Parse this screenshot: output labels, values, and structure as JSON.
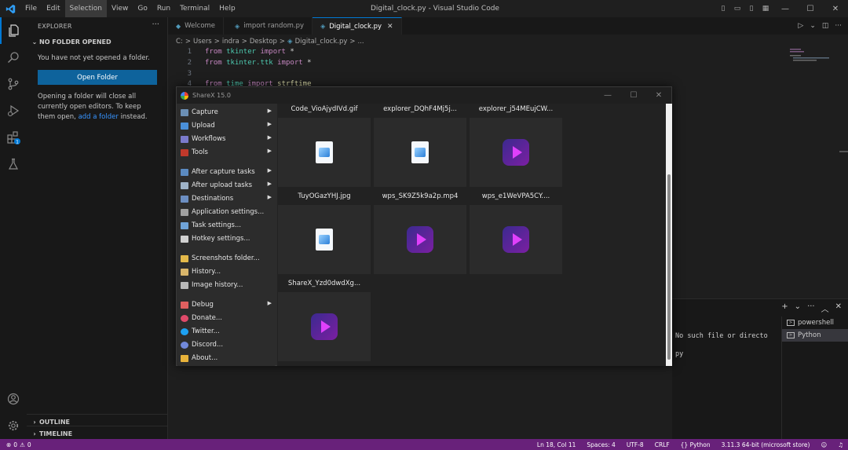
{
  "titlebar": {
    "menu": [
      "File",
      "Edit",
      "Selection",
      "View",
      "Go",
      "Run",
      "Terminal",
      "Help"
    ],
    "window_title": "Digital_clock.py - Visual Studio Code",
    "controls": {
      "minimize": "—",
      "maximize": "☐",
      "close": "✕"
    }
  },
  "sidebar": {
    "header": "EXPLORER",
    "more": "···",
    "section": "NO FOLDER OPENED",
    "message": "You have not yet opened a folder.",
    "open_folder_label": "Open Folder",
    "note_before": "Opening a folder will close all currently open editors. To keep them open,",
    "note_link": "add a folder",
    "note_after": "instead.",
    "outline": "OUTLINE",
    "timeline": "TIMELINE"
  },
  "tabs": [
    {
      "label": "Welcome",
      "icon": "vscode-icon",
      "active": false
    },
    {
      "label": "import random.py",
      "icon": "python-icon",
      "active": false
    },
    {
      "label": "Digital_clock.py",
      "icon": "python-icon",
      "active": true
    }
  ],
  "breadcrumb": [
    "C:",
    ">",
    "Users",
    ">",
    "indra",
    ">",
    "Desktop",
    ">",
    "Digital_clock.py",
    ">",
    "..."
  ],
  "code": {
    "line_numbers": [
      "1",
      "2",
      "3",
      "4"
    ],
    "line1": {
      "kw1": "from",
      "mod": "tkinter",
      "kw2": "import",
      "rest": "*"
    },
    "line2": {
      "kw1": "from",
      "mod": "tkinter.ttk",
      "kw2": "import",
      "rest": "*"
    },
    "line4": {
      "kw1": "from",
      "mod": "time",
      "kw2": "import",
      "id": "strftime"
    }
  },
  "terminal": {
    "output1": "No such file or directo",
    "output2": "py",
    "add": "+",
    "more": "···",
    "list": [
      "powershell",
      "Python"
    ]
  },
  "sharex": {
    "title": "ShareX 15.0",
    "menu": [
      {
        "label": "Capture",
        "submenu": true,
        "color": "#6b8fb5"
      },
      {
        "label": "Upload",
        "submenu": true,
        "color": "#4a90d9"
      },
      {
        "label": "Workflows",
        "submenu": true,
        "color": "#7a7acc"
      },
      {
        "label": "Tools",
        "submenu": true,
        "color": "#c0392b"
      },
      {
        "label": "After capture tasks",
        "submenu": true,
        "color": "#5b8ac0"
      },
      {
        "label": "After upload tasks",
        "submenu": true,
        "color": "#9fb3c8"
      },
      {
        "label": "Destinations",
        "submenu": true,
        "color": "#6c8ec2"
      },
      {
        "label": "Application settings...",
        "submenu": false,
        "color": "#a0a0a0"
      },
      {
        "label": "Task settings...",
        "submenu": false,
        "color": "#6fa3d8"
      },
      {
        "label": "Hotkey settings...",
        "submenu": false,
        "color": "#d0d0d0"
      },
      {
        "label": "Screenshots folder...",
        "submenu": false,
        "color": "#e3b94a"
      },
      {
        "label": "History...",
        "submenu": false,
        "color": "#d8b56b"
      },
      {
        "label": "Image history...",
        "submenu": false,
        "color": "#b8b8b8"
      },
      {
        "label": "Debug",
        "submenu": true,
        "color": "#e06060"
      },
      {
        "label": "Donate...",
        "submenu": false,
        "color": "#e04a6a"
      },
      {
        "label": "Twitter...",
        "submenu": false,
        "color": "#1da1f2"
      },
      {
        "label": "Discord...",
        "submenu": false,
        "color": "#7289da"
      },
      {
        "label": "About...",
        "submenu": false,
        "color": "#e8b23a"
      }
    ],
    "files": [
      {
        "name": "Code_VioAjydIVd.gif",
        "kind": "image"
      },
      {
        "name": "explorer_DQhF4Mj5j...",
        "kind": "image"
      },
      {
        "name": "explorer_j54MEujCW...",
        "kind": "video"
      },
      {
        "name": "TuyOGazYHJ.jpg",
        "kind": "image"
      },
      {
        "name": "wps_SK9Z5k9a2p.mp4",
        "kind": "video"
      },
      {
        "name": "wps_e1WeVPA5CY....",
        "kind": "video"
      },
      {
        "name": "ShareX_Yzd0dwdXg...",
        "kind": "video"
      }
    ]
  },
  "status": {
    "errors": "0",
    "warnings": "0",
    "position": "Ln 18, Col 11",
    "spaces": "Spaces: 4",
    "encoding": "UTF-8",
    "eol": "CRLF",
    "language": "Python",
    "interpreter": "3.11.3 64-bit (microsoft store)",
    "accent": "#68217a"
  }
}
